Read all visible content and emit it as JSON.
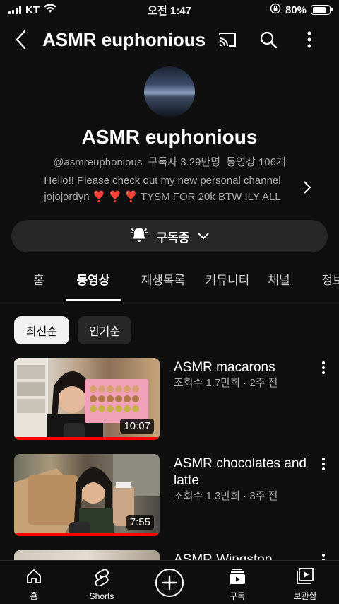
{
  "status_bar": {
    "carrier": "KT",
    "time": "오전 1:47",
    "battery": "80%",
    "battery_level": 0.8
  },
  "header": {
    "title": "ASMR euphonious"
  },
  "channel": {
    "name": "ASMR euphonious",
    "handle": "@asmreuphonious",
    "subscribers": "구독자 3.29만명",
    "videos": "동영상 106개",
    "description_line1": "Hello!! Please check out my new personal channel",
    "description_line2": "jojojordyn ❣️ ❣️ ❣️ TYSM FOR 20k BTW ILY ALL",
    "subscribe_label": "구독중"
  },
  "tabs": [
    "홈",
    "동영상",
    "재생목록",
    "커뮤니티",
    "채널",
    "정보"
  ],
  "active_tab": "동영상",
  "sort_chips": {
    "latest": "최신순",
    "popular": "인기순"
  },
  "videos": [
    {
      "title": "ASMR macarons",
      "meta": "조회수 1.7만회 · 2주 전",
      "duration": "10:07"
    },
    {
      "title": "ASMR chocolates and latte",
      "meta": "조회수 1.3만회 · 3주 전",
      "duration": "7:55"
    },
    {
      "title": "ASMR Wingstop",
      "meta": "",
      "duration": ""
    }
  ],
  "bottom_nav": {
    "home": "홈",
    "shorts": "Shorts",
    "subscriptions": "구독",
    "library": "보관함"
  },
  "colors": {
    "background": "#0f0f0f",
    "accent_red": "#ff0000",
    "chip_active": "#f1f1f1",
    "surface": "#272727"
  },
  "icons": [
    "signal-icon",
    "wifi-icon",
    "orientation-lock-icon",
    "battery-icon",
    "back-arrow-icon",
    "cast-icon",
    "search-icon",
    "more-vert-icon",
    "chevron-right-icon",
    "bell-icon",
    "chevron-down-icon",
    "home-icon",
    "shorts-icon",
    "create-plus-icon",
    "subscriptions-icon",
    "library-icon"
  ]
}
